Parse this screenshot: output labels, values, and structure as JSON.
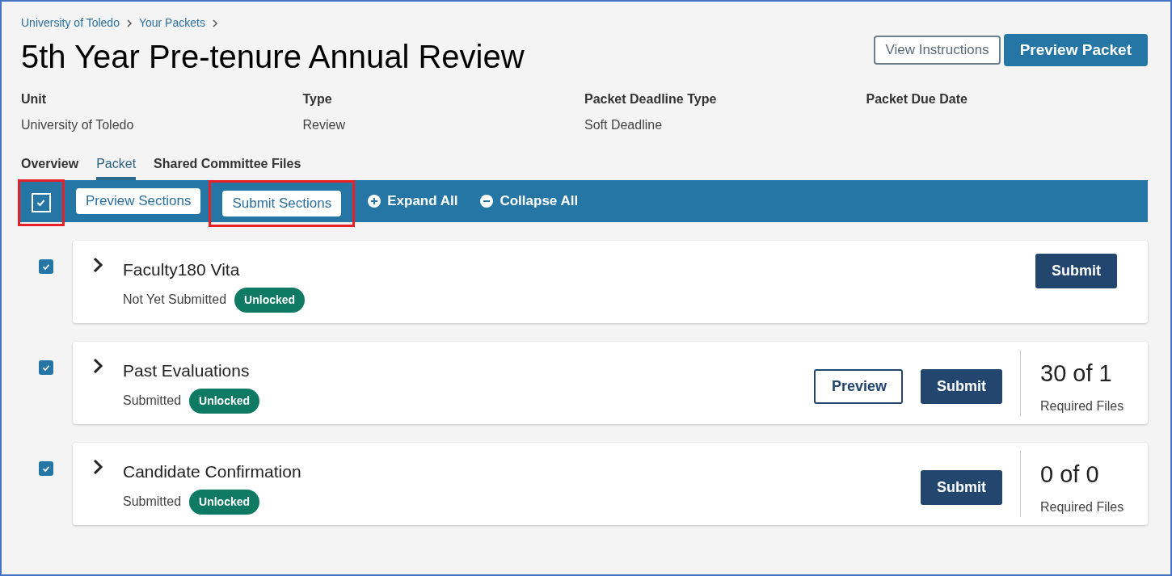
{
  "breadcrumb": [
    "University of Toledo",
    "Your Packets"
  ],
  "title": "5th Year Pre-tenure Annual Review",
  "header_buttons": [
    {
      "label": "View Instructions",
      "kind": "outline"
    },
    {
      "label": "Preview Packet",
      "kind": "primary"
    }
  ],
  "details": [
    {
      "label": "Unit",
      "value": "University of Toledo"
    },
    {
      "label": "Type",
      "value": "Review"
    },
    {
      "label": "Packet Deadline Type",
      "value": "Soft Deadline"
    },
    {
      "label": "Packet Due Date"
    }
  ],
  "tabs": [
    {
      "label": "Overview",
      "selected": false
    },
    {
      "label": "Packet",
      "selected": true
    },
    {
      "label": "Shared Committee Files",
      "selected": false
    }
  ],
  "toolbar": {
    "select_all": {
      "checked": true,
      "highlighted": true
    },
    "items": [
      {
        "kind": "button",
        "label": "Preview Sections",
        "highlighted": false
      },
      {
        "kind": "button",
        "label": "Submit Sections",
        "highlighted": true
      },
      {
        "kind": "expand",
        "label": "Expand All",
        "highlighted": false
      },
      {
        "kind": "collapse",
        "label": "Collapse All",
        "highlighted": false
      }
    ]
  },
  "sections": [
    {
      "name": "Faculty180 Vita",
      "checked": true,
      "expanded": false,
      "status": "Not Yet Submitted",
      "badge": "Unlocked",
      "actions": [
        "Submit"
      ]
    },
    {
      "name": "Past Evaluations",
      "checked": true,
      "expanded": false,
      "status": "Submitted",
      "badge": "Unlocked",
      "actions": [
        "Preview",
        "Submit"
      ],
      "files": {
        "count": "30 of 1",
        "label": "Required Files"
      }
    },
    {
      "name": "Candidate Confirmation",
      "checked": true,
      "expanded": false,
      "status": "Submitted",
      "badge": "Unlocked",
      "actions": [
        "Submit"
      ],
      "files": {
        "count": "0 of 0",
        "label": "Required Files"
      }
    }
  ]
}
